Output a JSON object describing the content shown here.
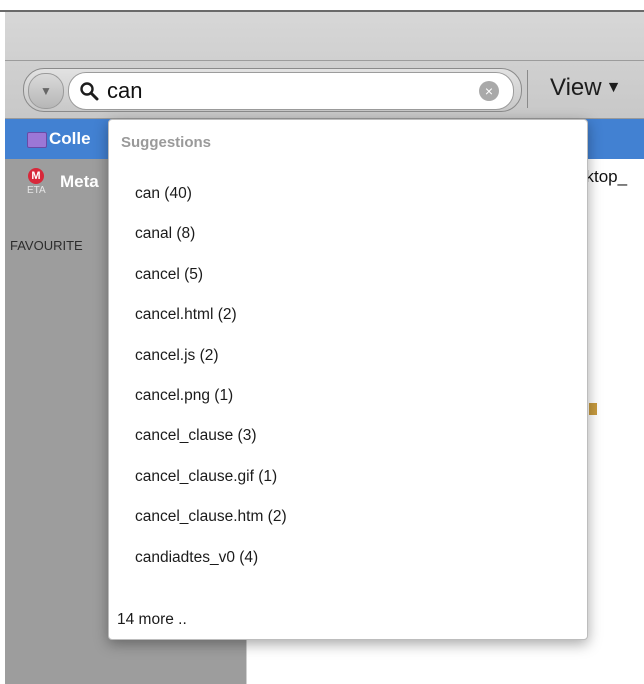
{
  "toolbar": {
    "search": {
      "value": "can",
      "placeholder": ""
    },
    "scope_arrow": "▼",
    "clear_glyph": "×",
    "view_label": "View",
    "view_arrow": "▼"
  },
  "sidebar": {
    "collections_label": "Colle",
    "metadata_label": "Meta",
    "metadata_icon_letter": "M",
    "metadata_icon_sub": "ETA",
    "favourites_heading": "FAVOURITE"
  },
  "content": {
    "path_text": "sktop_"
  },
  "suggestions": {
    "heading": "Suggestions",
    "items": [
      "can (40)",
      "canal (8)",
      "cancel (5)",
      "cancel.html (2)",
      "cancel.js (2)",
      "cancel.png (1)",
      "cancel_clause (3)",
      "cancel_clause.gif (1)",
      "cancel_clause.htm (2)",
      "candiadtes_v0 (4)"
    ],
    "more": "14 more .."
  },
  "colors": {
    "selection_blue": "#4281d2",
    "sidebar_gray": "#9d9d9d",
    "toolbar_gray": "#d0d0d0",
    "folder_purple": "#9c77d6",
    "meta_red": "#d8283a"
  }
}
